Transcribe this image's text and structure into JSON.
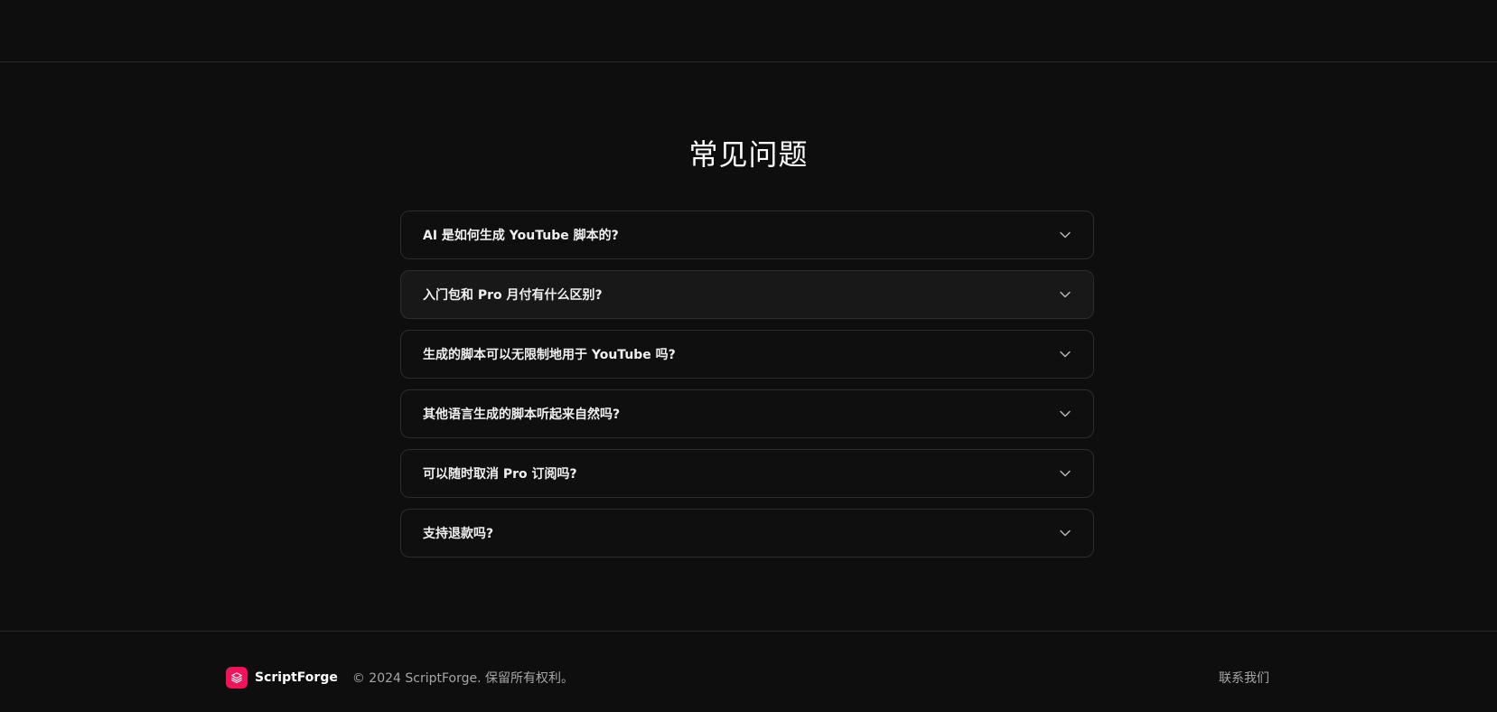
{
  "faq": {
    "title": "常见问题",
    "items": [
      {
        "question": "AI 是如何生成 YouTube 脚本的?"
      },
      {
        "question": "入门包和 Pro 月付有什么区别?"
      },
      {
        "question": "生成的脚本可以无限制地用于 YouTube 吗?"
      },
      {
        "question": "其他语言生成的脚本听起来自然吗?"
      },
      {
        "question": "可以随时取消 Pro 订阅吗?"
      },
      {
        "question": "支持退款吗?"
      }
    ],
    "expand_icon": "chevron-down-icon"
  },
  "footer": {
    "brand_name": "ScriptForge",
    "brand_icon": "layers-icon",
    "brand_color": "#f0135a",
    "copyright": "© 2024 ScriptForge. 保留所有权利。",
    "contact_label": "联系我们"
  },
  "colors": {
    "background": "#0e0e0e",
    "card_border": "#2d2d2d",
    "card_hover": "#181818"
  }
}
